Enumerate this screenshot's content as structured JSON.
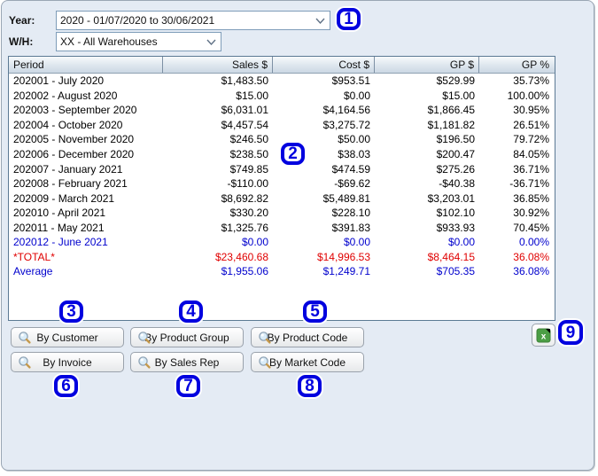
{
  "filters": {
    "year": {
      "label": "Year:",
      "value": "2020 - 01/07/2020 to 30/06/2021"
    },
    "warehouse": {
      "label": "W/H:",
      "value": "XX - All Warehouses"
    }
  },
  "table": {
    "columns": [
      "Period",
      "Sales $",
      "Cost $",
      "GP $",
      "GP %"
    ],
    "rows": [
      {
        "period": "202001 - July 2020",
        "sales": "$1,483.50",
        "cost": "$953.51",
        "gp": "$529.99",
        "gp_pct": "35.73%",
        "style": "normal"
      },
      {
        "period": "202002 - August 2020",
        "sales": "$15.00",
        "cost": "$0.00",
        "gp": "$15.00",
        "gp_pct": "100.00%",
        "style": "normal"
      },
      {
        "period": "202003 - September 2020",
        "sales": "$6,031.01",
        "cost": "$4,164.56",
        "gp": "$1,866.45",
        "gp_pct": "30.95%",
        "style": "normal"
      },
      {
        "period": "202004 - October 2020",
        "sales": "$4,457.54",
        "cost": "$3,275.72",
        "gp": "$1,181.82",
        "gp_pct": "26.51%",
        "style": "normal"
      },
      {
        "period": "202005 - November 2020",
        "sales": "$246.50",
        "cost": "$50.00",
        "gp": "$196.50",
        "gp_pct": "79.72%",
        "style": "normal"
      },
      {
        "period": "202006 - December 2020",
        "sales": "$238.50",
        "cost": "$38.03",
        "gp": "$200.47",
        "gp_pct": "84.05%",
        "style": "normal"
      },
      {
        "period": "202007 - January 2021",
        "sales": "$749.85",
        "cost": "$474.59",
        "gp": "$275.26",
        "gp_pct": "36.71%",
        "style": "normal"
      },
      {
        "period": "202008 - February 2021",
        "sales": "-$110.00",
        "cost": "-$69.62",
        "gp": "-$40.38",
        "gp_pct": "-36.71%",
        "style": "normal"
      },
      {
        "period": "202009 - March 2021",
        "sales": "$8,692.82",
        "cost": "$5,489.81",
        "gp": "$3,203.01",
        "gp_pct": "36.85%",
        "style": "normal"
      },
      {
        "period": "202010 - April 2021",
        "sales": "$330.20",
        "cost": "$228.10",
        "gp": "$102.10",
        "gp_pct": "30.92%",
        "style": "normal"
      },
      {
        "period": "202011 - May 2021",
        "sales": "$1,325.76",
        "cost": "$391.83",
        "gp": "$933.93",
        "gp_pct": "70.45%",
        "style": "normal"
      },
      {
        "period": "202012 - June 2021",
        "sales": "$0.00",
        "cost": "$0.00",
        "gp": "$0.00",
        "gp_pct": "0.00%",
        "style": "highlight-blue"
      },
      {
        "period": "*TOTAL*",
        "sales": "$23,460.68",
        "cost": "$14,996.53",
        "gp": "$8,464.15",
        "gp_pct": "36.08%",
        "style": "total-red"
      },
      {
        "period": "Average",
        "sales": "$1,955.06",
        "cost": "$1,249.71",
        "gp": "$705.35",
        "gp_pct": "36.08%",
        "style": "highlight-blue"
      }
    ]
  },
  "buttons": [
    {
      "label": "By Customer"
    },
    {
      "label": "By Product Group"
    },
    {
      "label": "By Product Code"
    },
    {
      "label": "By Invoice"
    },
    {
      "label": "By Sales Rep"
    },
    {
      "label": "By Market Code"
    }
  ],
  "export": {
    "tooltip_icon": "excel-export-icon"
  },
  "callouts": [
    "1",
    "2",
    "3",
    "4",
    "5",
    "6",
    "7",
    "8",
    "9"
  ],
  "colors": {
    "callout_blue": "#0101df",
    "total_red": "#e00000",
    "accent_blue": "#0000cd",
    "panel_bg": "#e4ebf4",
    "excel_green": "#4b9e45"
  }
}
